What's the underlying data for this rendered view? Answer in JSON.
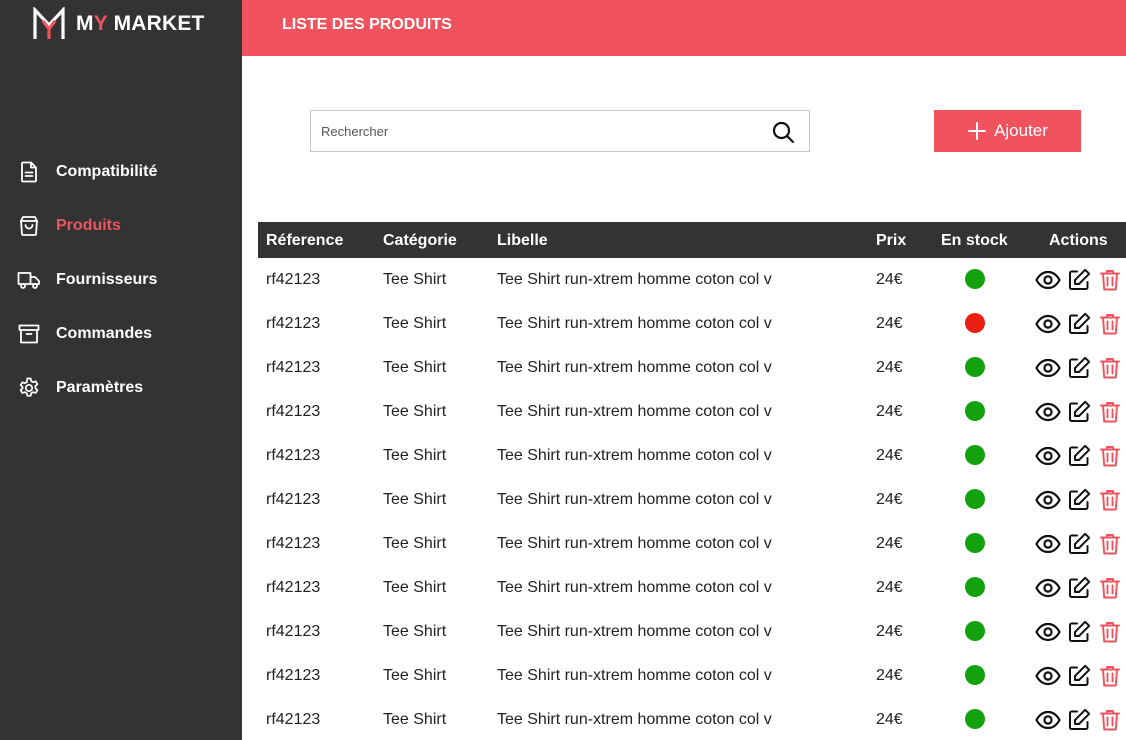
{
  "brand": {
    "prefix": "M",
    "accent": "Y",
    "suffix": " MARKET"
  },
  "colors": {
    "accent": "#f0535d",
    "sidebar": "#333333",
    "in_stock": "#13a10e",
    "out_of_stock": "#e81f11"
  },
  "sidebar": {
    "items": [
      {
        "label": "Compatibilité",
        "icon": "document-icon",
        "active": false
      },
      {
        "label": "Produits",
        "icon": "shopping-bag-icon",
        "active": true
      },
      {
        "label": "Fournisseurs",
        "icon": "truck-icon",
        "active": false
      },
      {
        "label": "Commandes",
        "icon": "archive-box-icon",
        "active": false
      },
      {
        "label": "Paramètres",
        "icon": "gear-icon",
        "active": false
      }
    ]
  },
  "header": {
    "title": "LISTE DES PRODUITS"
  },
  "toolbar": {
    "search_placeholder": "Rechercher",
    "search_value": "",
    "add_label": "Ajouter"
  },
  "table": {
    "headers": {
      "reference": "Réference",
      "categorie": "Catégorie",
      "libelle": "Libelle",
      "prix": "Prix",
      "stock": "En stock",
      "actions": "Actions"
    },
    "rows": [
      {
        "reference": "rf42123",
        "categorie": "Tee Shirt",
        "libelle": "Tee Shirt run-xtrem homme coton col v",
        "prix": "24€",
        "in_stock": true
      },
      {
        "reference": "rf42123",
        "categorie": "Tee Shirt",
        "libelle": "Tee Shirt run-xtrem homme coton col v",
        "prix": "24€",
        "in_stock": false
      },
      {
        "reference": "rf42123",
        "categorie": "Tee Shirt",
        "libelle": "Tee Shirt run-xtrem homme coton col v",
        "prix": "24€",
        "in_stock": true
      },
      {
        "reference": "rf42123",
        "categorie": "Tee Shirt",
        "libelle": "Tee Shirt run-xtrem homme coton col v",
        "prix": "24€",
        "in_stock": true
      },
      {
        "reference": "rf42123",
        "categorie": "Tee Shirt",
        "libelle": "Tee Shirt run-xtrem homme coton col v",
        "prix": "24€",
        "in_stock": true
      },
      {
        "reference": "rf42123",
        "categorie": "Tee Shirt",
        "libelle": "Tee Shirt run-xtrem homme coton col v",
        "prix": "24€",
        "in_stock": true
      },
      {
        "reference": "rf42123",
        "categorie": "Tee Shirt",
        "libelle": "Tee Shirt run-xtrem homme coton col v",
        "prix": "24€",
        "in_stock": true
      },
      {
        "reference": "rf42123",
        "categorie": "Tee Shirt",
        "libelle": "Tee Shirt run-xtrem homme coton col v",
        "prix": "24€",
        "in_stock": true
      },
      {
        "reference": "rf42123",
        "categorie": "Tee Shirt",
        "libelle": "Tee Shirt run-xtrem homme coton col v",
        "prix": "24€",
        "in_stock": true
      },
      {
        "reference": "rf42123",
        "categorie": "Tee Shirt",
        "libelle": "Tee Shirt run-xtrem homme coton col v",
        "prix": "24€",
        "in_stock": true
      },
      {
        "reference": "rf42123",
        "categorie": "Tee Shirt",
        "libelle": "Tee Shirt run-xtrem homme coton col v",
        "prix": "24€",
        "in_stock": true
      }
    ]
  }
}
